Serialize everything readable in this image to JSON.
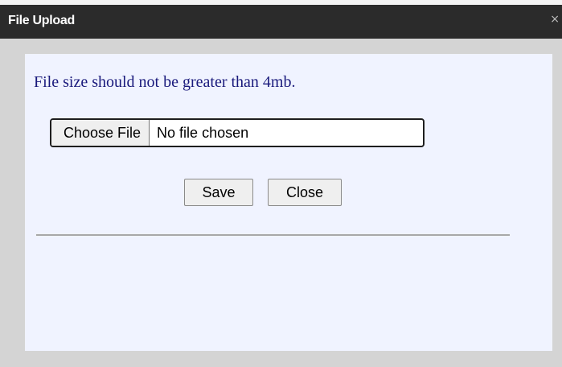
{
  "dialog": {
    "title": "File Upload",
    "close_glyph": "×",
    "close_icon": "close-icon"
  },
  "content": {
    "message": "File size should not be greater than 4mb.",
    "file_input": {
      "button_label": "Choose File",
      "status_text": "No file chosen"
    },
    "buttons": {
      "save_label": "Save",
      "close_label": "Close"
    }
  },
  "colors": {
    "titlebar": "#2b2b2b",
    "content_bg": "#f0f3ff",
    "message_text": "#1a1a7c",
    "frame": "#d4d4d4"
  }
}
